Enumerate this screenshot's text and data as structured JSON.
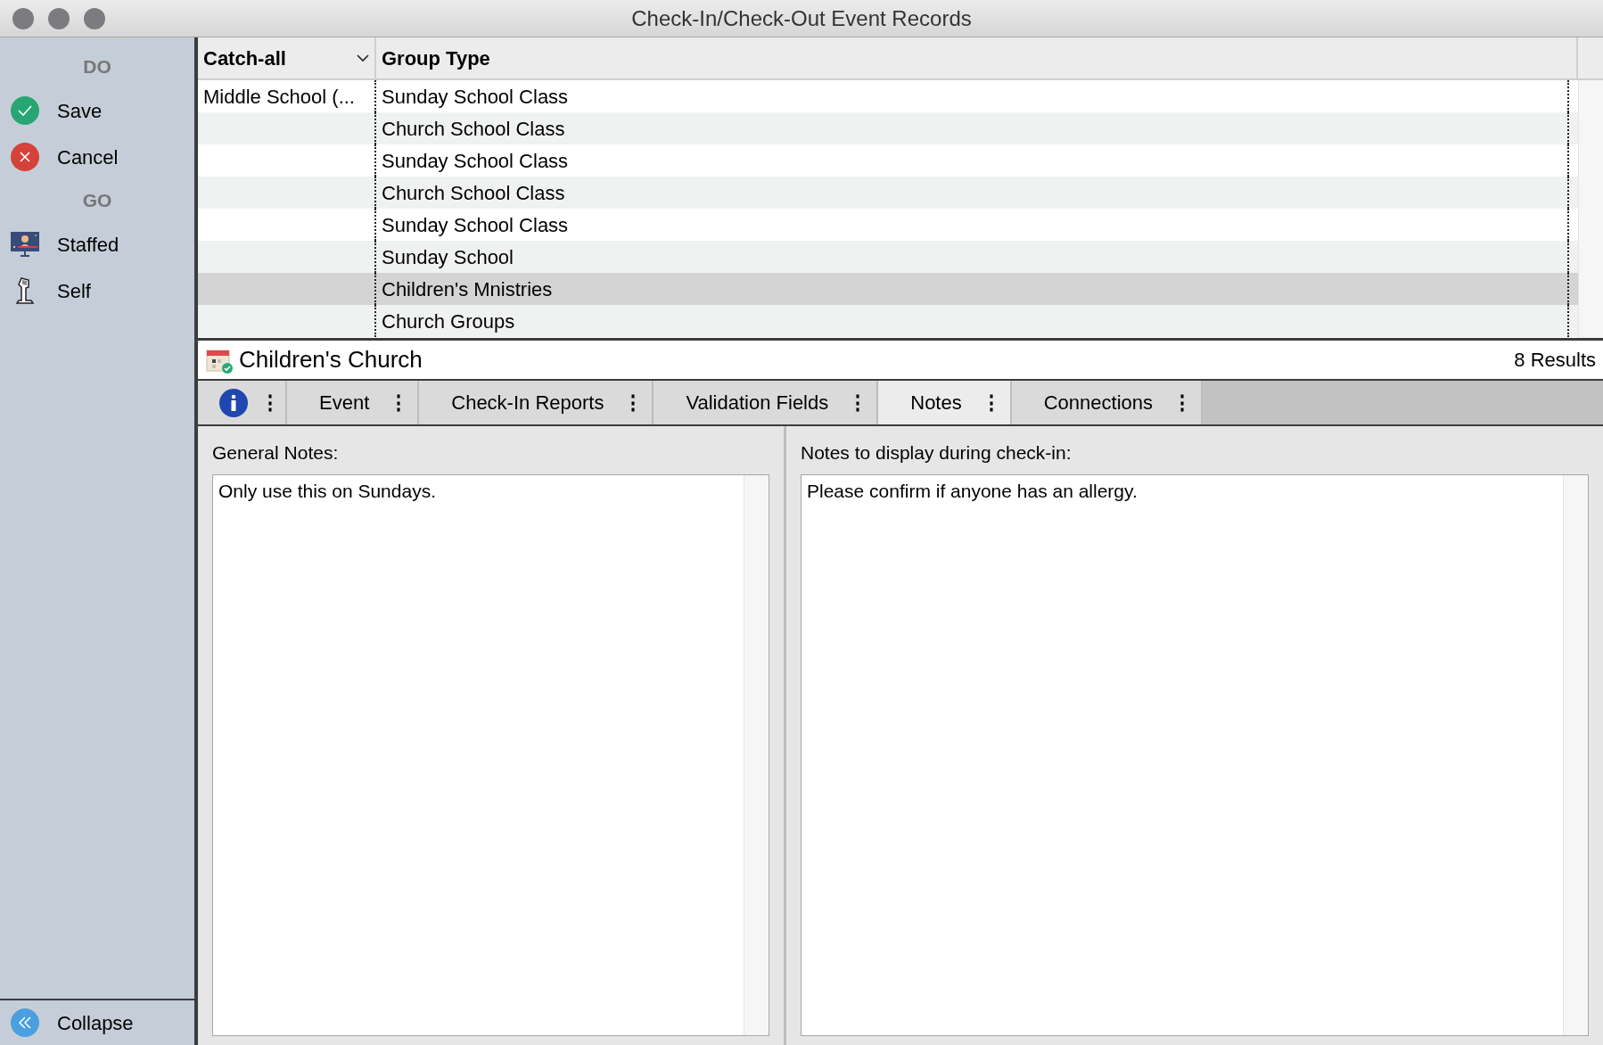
{
  "window": {
    "title": "Check-In/Check-Out Event Records"
  },
  "sidebar": {
    "sections": [
      {
        "heading": "DO",
        "items": [
          {
            "label": "Save",
            "kind": "save"
          },
          {
            "label": "Cancel",
            "kind": "cancel"
          }
        ]
      },
      {
        "heading": "GO",
        "items": [
          {
            "label": "Staffed",
            "kind": "staffed"
          },
          {
            "label": "Self",
            "kind": "self"
          }
        ]
      }
    ],
    "collapse": "Collapse"
  },
  "table": {
    "columns": [
      "Catch-all",
      "Group Type"
    ],
    "rows": [
      {
        "cells": [
          "Middle School (...",
          "Sunday School Class"
        ],
        "selected": false
      },
      {
        "cells": [
          "",
          "Church School Class"
        ],
        "selected": false
      },
      {
        "cells": [
          "",
          "Sunday School Class"
        ],
        "selected": false
      },
      {
        "cells": [
          "",
          "Church School Class"
        ],
        "selected": false
      },
      {
        "cells": [
          "",
          "Sunday School Class"
        ],
        "selected": false
      },
      {
        "cells": [
          "",
          "Sunday School"
        ],
        "selected": false
      },
      {
        "cells": [
          "",
          "Children's Mnistries"
        ],
        "selected": true
      },
      {
        "cells": [
          "",
          "Church Groups"
        ],
        "selected": false
      }
    ]
  },
  "record": {
    "title": "Children's Church",
    "results": "8 Results"
  },
  "tabs": [
    {
      "kind": "info",
      "selected": false
    },
    {
      "kind": "text",
      "label": "Event",
      "selected": false
    },
    {
      "kind": "text",
      "label": "Check-In Reports",
      "selected": false
    },
    {
      "kind": "text",
      "label": "Validation Fields",
      "selected": false
    },
    {
      "kind": "text",
      "label": "Notes",
      "selected": true
    },
    {
      "kind": "text",
      "label": "Connections",
      "selected": false
    }
  ],
  "tab_menu": "⋮",
  "notes": [
    {
      "label": "General Notes:",
      "value": "Only use this on Sundays."
    },
    {
      "label": "Notes to display during check-in:",
      "value": "Please confirm if anyone has an allergy."
    }
  ]
}
